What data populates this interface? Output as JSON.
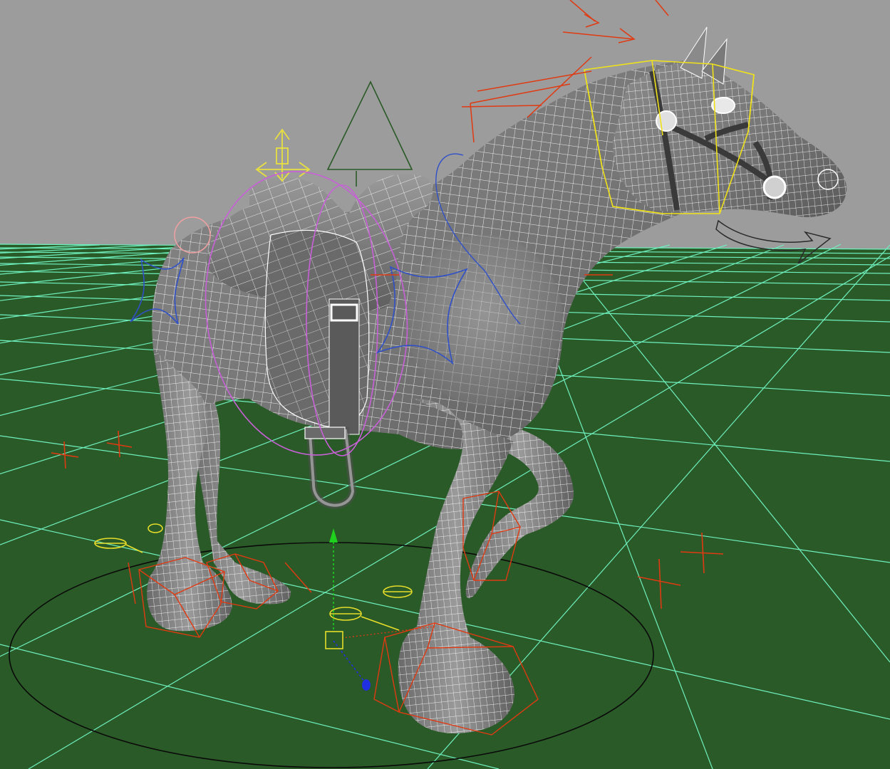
{
  "viewport": {
    "label": "",
    "colors": {
      "background": "#9c9c9c",
      "ground": "#2a5a27",
      "grid": "#6ff0bf",
      "mesh_fill": "#7f7f7f",
      "wire": "#ffffff",
      "ik_controls": "#e03a12",
      "head_control": "#f0e21a",
      "foot_pivots": "#e6dc2a",
      "spine_controls": "#3050c8",
      "saddle_rings": "#c860d8",
      "root_circle": "#0a0a0a",
      "move_gizmo": "#e8e040",
      "manipulator_y": "#1fd01f",
      "manipulator_z": "#2030e0"
    }
  },
  "rig": {
    "controls": [
      "head-box",
      "move-gizmo",
      "body-triangle",
      "left-front-hoof-box",
      "right-front-hoof-box",
      "left-hind-hoof-box",
      "right-hind-hoof-box",
      "root-circle",
      "spine-star-front",
      "spine-star-back",
      "saddle-ring",
      "knee-locators",
      "foot-pivots",
      "manipulator"
    ]
  }
}
